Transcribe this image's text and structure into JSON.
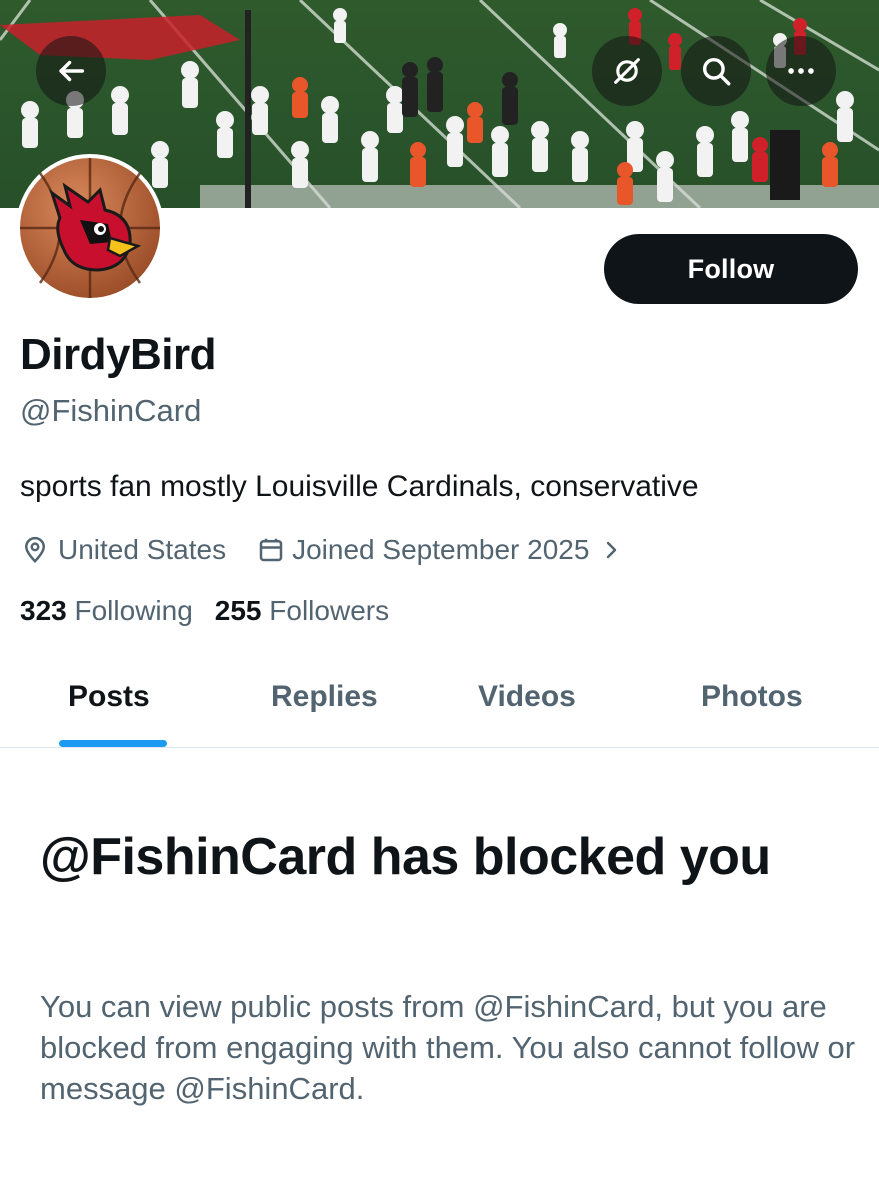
{
  "header": {
    "back_icon": "arrow-left-icon",
    "actions": [
      "no-notifications-icon",
      "search-icon",
      "more-icon"
    ]
  },
  "profile": {
    "display_name": "DirdyBird",
    "handle": "@FishinCard",
    "bio": "sports fan mostly Louisville Cardinals, conservative",
    "location": "United States",
    "joined": "Joined September 2025",
    "following_count": "323",
    "following_label": "Following",
    "followers_count": "255",
    "followers_label": "Followers"
  },
  "follow_button": {
    "label": "Follow"
  },
  "tabs": [
    {
      "label": "Posts",
      "active": true
    },
    {
      "label": "Replies",
      "active": false
    },
    {
      "label": "Videos",
      "active": false
    },
    {
      "label": "Photos",
      "active": false
    }
  ],
  "blocked_notice": {
    "title": "@FishinCard has blocked you",
    "description": "You can view public posts from @FishinCard, but you are blocked from engaging with them. You also cannot follow or message @FishinCard."
  },
  "colors": {
    "text_primary": "#0f1419",
    "text_secondary": "#536471",
    "accent": "#1d9bf0",
    "button_bg": "#0f1419"
  }
}
